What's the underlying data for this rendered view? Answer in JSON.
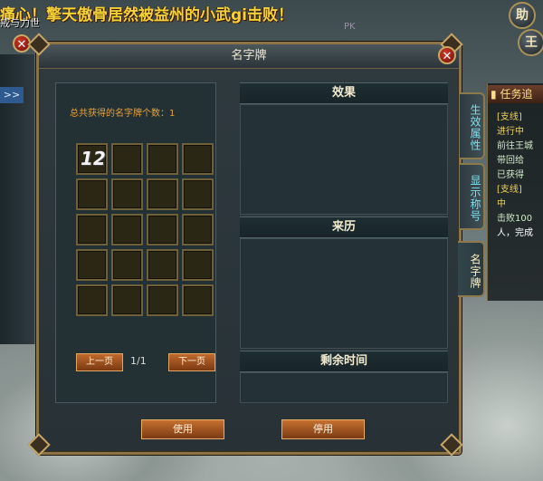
{
  "hud": {
    "banner": "痛心！擎天傲骨居然被益州的小武gi击败！",
    "top_tag": "戒与力世",
    "blurred_text": "PK",
    "help_btn": "助",
    "king_btn": "王"
  },
  "left_strip": {
    "expand_label": ">>"
  },
  "quest": {
    "title": "任务追",
    "lines": [
      {
        "text": "[支线]",
        "color": "#f0d35b"
      },
      {
        "text": "进行中",
        "color": "#f0d35b"
      },
      {
        "text": "前往王城",
        "color": "#cfe9c9"
      },
      {
        "text": "带回给",
        "color": "#cfe9c9"
      },
      {
        "text": "已获得",
        "color": "#cfe9c9"
      },
      {
        "text": "[支线]",
        "color": "#f0d35b"
      },
      {
        "text": "中",
        "color": "#f0d35b"
      },
      {
        "text": "击败100",
        "color": "#cfe9c9"
      },
      {
        "text": "人，完成",
        "color": "#ffffff"
      }
    ]
  },
  "window": {
    "title": "名字牌",
    "count_label": "总共获得的名字牌个数：1",
    "slot_badge": "12",
    "prev_label": "上一页",
    "next_label": "下一页",
    "page_indicator": "1/1",
    "sections": {
      "effect": "效果",
      "origin": "来历",
      "remaining": "剩余时间"
    },
    "use_label": "使用",
    "disable_label": "停用",
    "tabs": [
      "生效属性",
      "显示称号",
      "名字牌"
    ],
    "active_tab": 2
  }
}
